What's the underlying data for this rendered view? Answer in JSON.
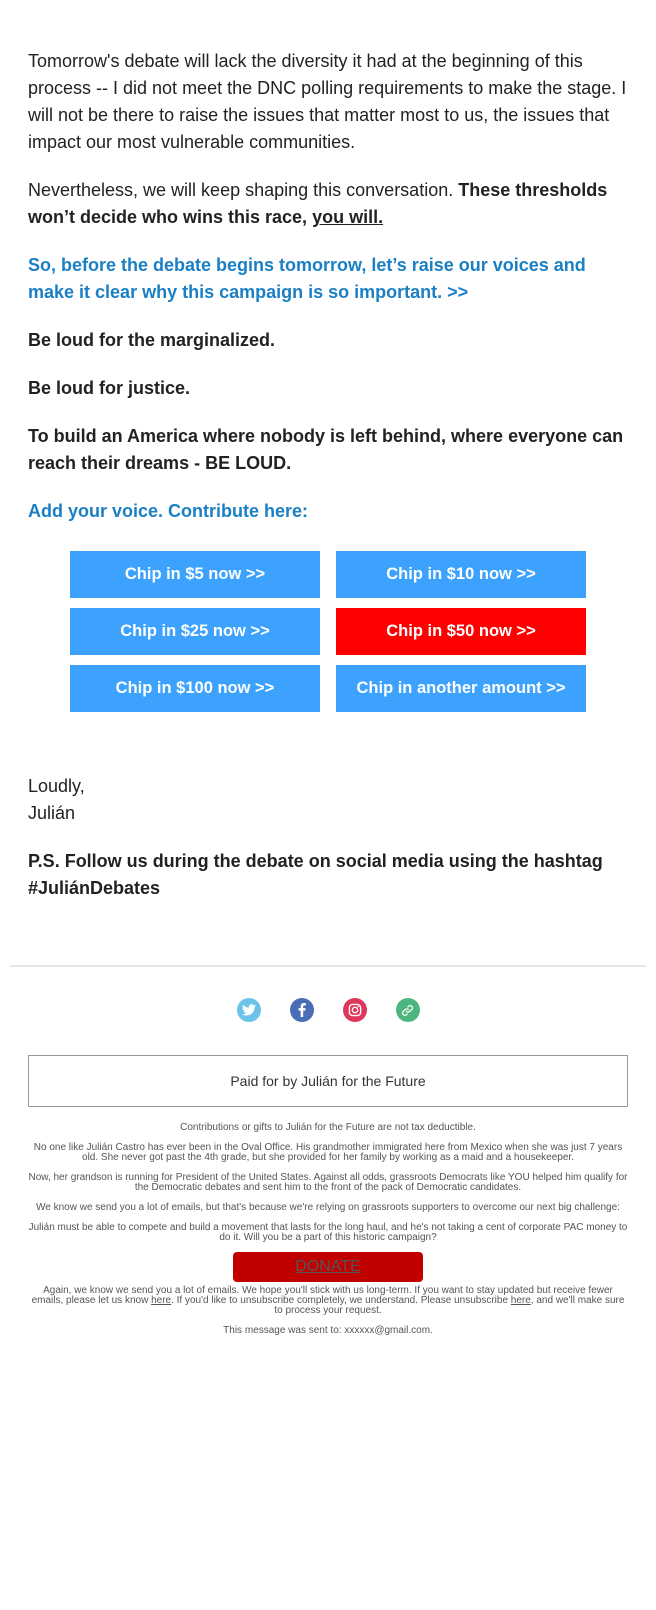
{
  "body": {
    "p1": "Tomorrow's debate will lack the diversity it had at the beginning of this process -- I did not meet the DNC polling requirements to make the stage. I will not be there to raise the issues that matter most to us, the issues that impact our most vulnerable communities.",
    "p2_plain": "Nevertheless, we will keep shaping this conversation. ",
    "p2_bold": "These thresholds won’t decide who wins this race, ",
    "p2_underline": "you will.",
    "cta_link": "So, before the debate begins tomorrow, let’s raise our voices and make it clear why this campaign is so important. >>",
    "line_marginalized": "Be loud for the marginalized.",
    "line_justice": "Be loud for justice.",
    "line_america": "To build an America where nobody is left behind, where everyone can reach their dreams - BE LOUD.",
    "contribute_heading": "Add your voice. Contribute here:"
  },
  "chips": [
    {
      "label": "Chip in $5 now >>",
      "color": "#3ca2fd"
    },
    {
      "label": "Chip in $10 now >>",
      "color": "#3ca2fd"
    },
    {
      "label": "Chip in $25 now >>",
      "color": "#3ca2fd"
    },
    {
      "label": "Chip in $50 now >>",
      "color": "#ff0000"
    },
    {
      "label": "Chip in $100 now >>",
      "color": "#3ca2fd"
    },
    {
      "label": "Chip in another amount >>",
      "color": "#3ca2fd"
    }
  ],
  "signoff": {
    "closing": "Loudly,",
    "name": "Julián"
  },
  "ps": "P.S. Follow us during the debate on social media using the hashtag #JuliánDebates",
  "social": [
    {
      "icon": "twitter-icon",
      "color": "#6cc3ea"
    },
    {
      "icon": "facebook-icon",
      "color": "#4a6db5"
    },
    {
      "icon": "instagram-icon",
      "color": "#e0365a"
    },
    {
      "icon": "link-icon",
      "color": "#4db57e"
    }
  ],
  "paid_for": "Paid for by Julián for the Future",
  "footer": {
    "tax": "Contributions or gifts to Julián for the Future are not tax deductible.",
    "grandmother": "No one like Julián Castro has ever been in the Oval Office. His grandmother immigrated here from Mexico when she was just 7 years old. She never got past the 4th grade, but she provided for her family by working as a maid and a housekeeper.",
    "grandson": "Now, her grandson is running for President of the United States. Against all odds, grassroots Democrats like YOU helped him qualify for the Democratic debates and sent him to the front of the pack of Democratic candidates.",
    "emails": "We know we send you a lot of emails, but that's because we're relying on grassroots supporters to overcome our next big challenge:",
    "compete": "Julián must be able to compete and build a movement that lasts for the long haul, and he's not taking a cent of corporate PAC money to do it. Will you be a part of this historic campaign?",
    "donate_label": "DONATE",
    "donate_color": "#c00000",
    "again_1": "Again, we know we send you a lot of emails. We hope you'll stick with us long-term. If you want to stay updated but receive fewer emails, please let us know ",
    "here_1": "here",
    "again_2": ". If you'd like to unsubscribe completely, we understand. Please unsubscribe ",
    "here_2": "here",
    "again_3": ", and we'll make sure to process your request.",
    "sent_to": "This message was sent to: xxxxxx@gmail.com."
  }
}
